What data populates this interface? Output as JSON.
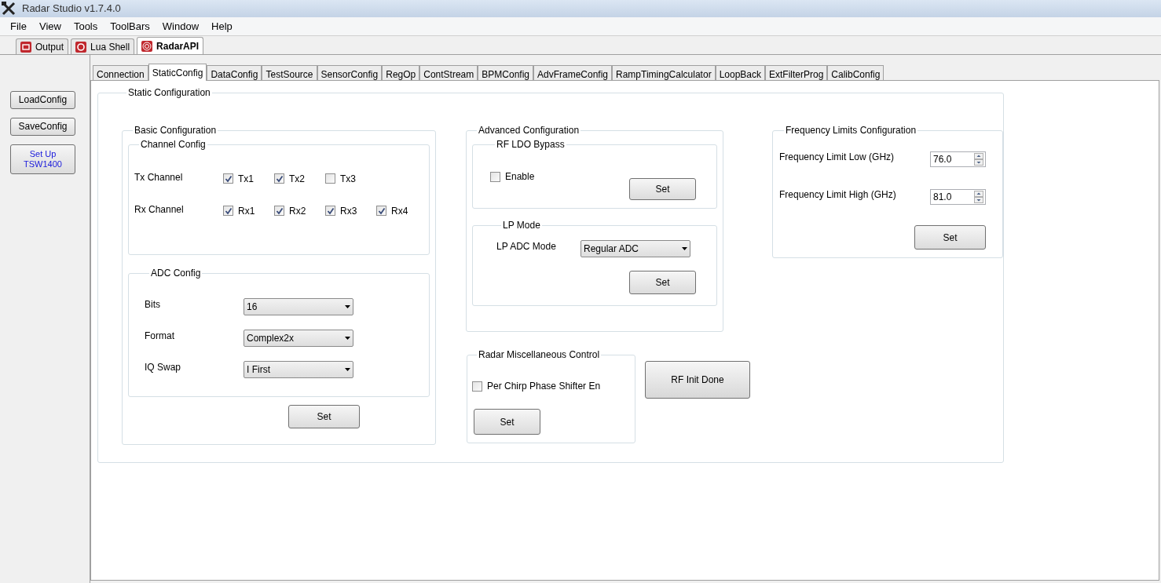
{
  "window": {
    "title": "Radar Studio v1.7.4.0"
  },
  "menu": [
    "File",
    "View",
    "Tools",
    "ToolBars",
    "Window",
    "Help"
  ],
  "doc_tabs": [
    {
      "label": "Output",
      "kind": "output",
      "selected": false
    },
    {
      "label": "Lua Shell",
      "kind": "shell",
      "selected": false
    },
    {
      "label": "RadarAPI",
      "kind": "radar",
      "selected": true
    }
  ],
  "side_buttons": [
    {
      "lines": [
        "LoadConfig"
      ],
      "kind": "plain"
    },
    {
      "lines": [
        "SaveConfig"
      ],
      "kind": "plain"
    },
    {
      "lines": [
        "Set Up",
        "TSW1400"
      ],
      "kind": "link"
    }
  ],
  "tabs": [
    {
      "label": "Connection",
      "selected": false
    },
    {
      "label": "StaticConfig",
      "selected": true
    },
    {
      "label": "DataConfig",
      "selected": false
    },
    {
      "label": "TestSource",
      "selected": false
    },
    {
      "label": "SensorConfig",
      "selected": false
    },
    {
      "label": "RegOp",
      "selected": false
    },
    {
      "label": "ContStream",
      "selected": false
    },
    {
      "label": "BPMConfig",
      "selected": false
    },
    {
      "label": "AdvFrameConfig",
      "selected": false
    },
    {
      "label": "RampTimingCalculator",
      "selected": false
    },
    {
      "label": "LoopBack",
      "selected": false
    },
    {
      "label": "ExtFilterProg",
      "selected": false
    },
    {
      "label": "CalibConfig",
      "selected": false
    }
  ],
  "static_config": {
    "title": "Static Configuration",
    "basic": {
      "title": "Basic Configuration",
      "channel": {
        "title": "Channel Config",
        "rows": [
          {
            "label": "Tx Channel",
            "channels": [
              {
                "label": "Tx1",
                "checked": true
              },
              {
                "label": "Tx2",
                "checked": true
              },
              {
                "label": "Tx3",
                "checked": false
              }
            ]
          },
          {
            "label": "Rx Channel",
            "channels": [
              {
                "label": "Rx1",
                "checked": true
              },
              {
                "label": "Rx2",
                "checked": true
              },
              {
                "label": "Rx3",
                "checked": true
              },
              {
                "label": "Rx4",
                "checked": true
              }
            ]
          }
        ]
      },
      "adc": {
        "title": "ADC Config",
        "fields": [
          {
            "label": "Bits",
            "value": "16"
          },
          {
            "label": "Format",
            "value": "Complex2x"
          },
          {
            "label": "IQ Swap",
            "value": "I First"
          }
        ]
      },
      "set_button": "Set"
    },
    "advanced": {
      "title": "Advanced Configuration",
      "rf_ldo": {
        "title": "RF LDO Bypass",
        "option": {
          "label": "Enable",
          "checked": false
        },
        "set_button": "Set"
      },
      "lp_mode": {
        "title": "LP Mode",
        "label": "LP ADC Mode",
        "value": "Regular ADC",
        "set_button": "Set"
      }
    },
    "misc": {
      "title": "Radar Miscellaneous Control",
      "option": {
        "label": "Per Chirp Phase Shifter En",
        "checked": false
      },
      "set_button": "Set"
    },
    "rf_init_button": "RF Init Done",
    "freq": {
      "title": "Frequency Limits Configuration",
      "fields": [
        {
          "label": "Frequency Limit Low (GHz)",
          "value": "76.0"
        },
        {
          "label": "Frequency Limit High (GHz)",
          "value": "81.0"
        }
      ],
      "set_button": "Set"
    }
  }
}
